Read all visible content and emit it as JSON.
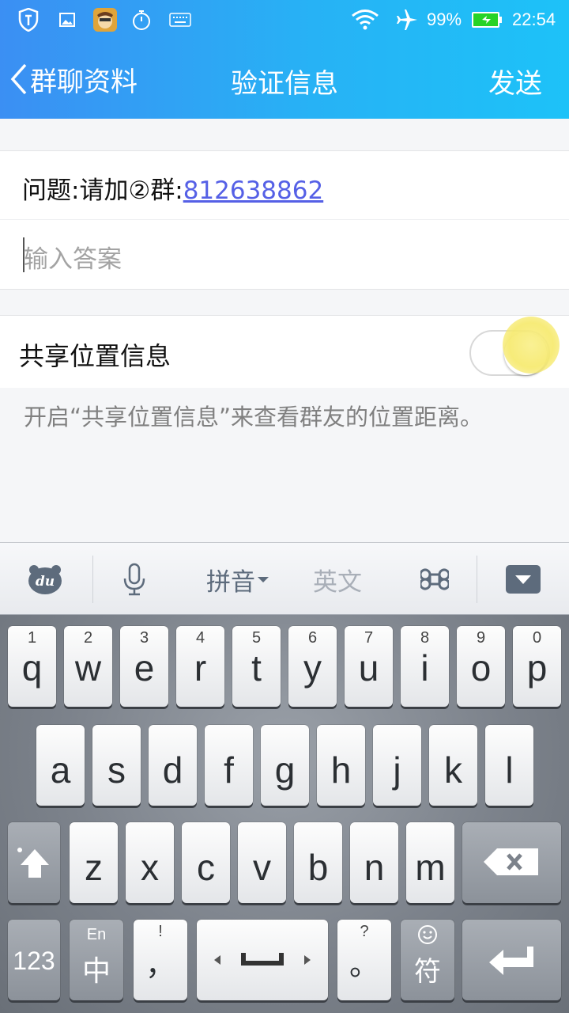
{
  "status_bar": {
    "icons": [
      "shield-icon",
      "image-icon",
      "app-avatar-icon",
      "stopwatch-icon",
      "keyboard-icon",
      "wifi-icon",
      "airplane-icon",
      "battery-icon"
    ],
    "battery": "99%",
    "time": "22:54",
    "battery_color": "#27d327"
  },
  "nav": {
    "back_label": "群聊资料",
    "title": "验证信息",
    "send_label": "发送"
  },
  "form": {
    "question_prefix": "问题:请加②群:",
    "question_number": "812638862",
    "answer_placeholder": "输入答案",
    "share_label": "共享位置信息",
    "share_enabled": false,
    "hint": "开启“共享位置信息”来查看群友的位置距离。"
  },
  "keyboard_toolbar": {
    "logo": "du",
    "mic": "microphone-icon",
    "pinyin": "拼音",
    "english": "英文",
    "command": "command-icon",
    "collapse": "collapse-keyboard-icon"
  },
  "keyboard": {
    "row1": [
      {
        "num": "1",
        "letter": "q"
      },
      {
        "num": "2",
        "letter": "w"
      },
      {
        "num": "3",
        "letter": "e"
      },
      {
        "num": "4",
        "letter": "r"
      },
      {
        "num": "5",
        "letter": "t"
      },
      {
        "num": "6",
        "letter": "y"
      },
      {
        "num": "7",
        "letter": "u"
      },
      {
        "num": "8",
        "letter": "i"
      },
      {
        "num": "9",
        "letter": "o"
      },
      {
        "num": "0",
        "letter": "p"
      }
    ],
    "row2": [
      "a",
      "s",
      "d",
      "f",
      "g",
      "h",
      "j",
      "k",
      "l"
    ],
    "row3": [
      "z",
      "x",
      "c",
      "v",
      "b",
      "n",
      "m"
    ],
    "num_key": "123",
    "lang_key_top": "En",
    "lang_key": "中",
    "comma_top": "!",
    "comma": "，",
    "period_top": "?",
    "period": "。",
    "symbol_key": "符",
    "accent_color": "#3b8ff3"
  }
}
